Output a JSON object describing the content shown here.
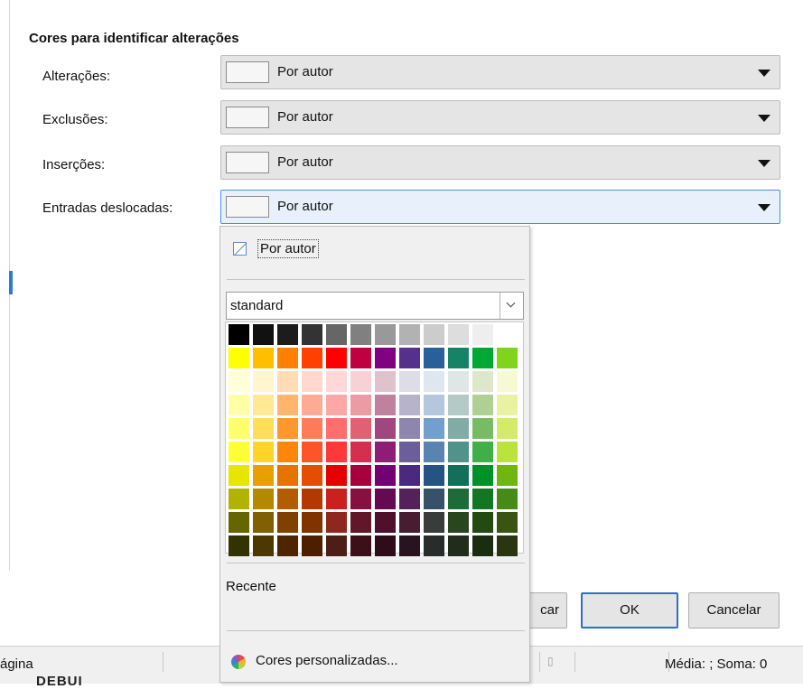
{
  "dialog": {
    "section_title": "Cores para identificar alterações",
    "rows": [
      {
        "label": "Alterações:",
        "value": "Por autor"
      },
      {
        "label": "Exclusões:",
        "value": "Por autor"
      },
      {
        "label": "Inserções:",
        "value": "Por autor"
      },
      {
        "label": "Entradas deslocadas:",
        "value": "Por autor"
      }
    ],
    "buttons": {
      "apply_partial": "car",
      "ok": "OK",
      "cancel": "Cancelar"
    }
  },
  "popup": {
    "auto_label": "Por autor",
    "palette_name": "standard",
    "recent_label": "Recente",
    "custom_colors_label": "Cores personalizadas...",
    "palette_colors": [
      [
        "#000000",
        "#111111",
        "#1c1c1c",
        "#333333",
        "#666666",
        "#808080",
        "#999999",
        "#b2b2b2",
        "#cccccc",
        "#dddddd",
        "#eeeeee",
        "#ffffff"
      ],
      [
        "#ffff00",
        "#ffbf00",
        "#ff8000",
        "#ff4000",
        "#ff0000",
        "#bf0041",
        "#800080",
        "#55308d",
        "#2a6099",
        "#158466",
        "#00a933",
        "#81d41a"
      ],
      [
        "#ffffd7",
        "#fff5ce",
        "#ffdbb6",
        "#ffd8ce",
        "#ffd7d7",
        "#f7d1d5",
        "#e0c2cd",
        "#dedce6",
        "#dee6ef",
        "#dee7e5",
        "#dde8cb",
        "#f6f9d4"
      ],
      [
        "#ffffa6",
        "#ffe994",
        "#ffb66c",
        "#ffaa95",
        "#ffa6a6",
        "#ec9ba4",
        "#bf819e",
        "#b7b3ca",
        "#b4c7dc",
        "#b3cac7",
        "#afd095",
        "#e8f2a1"
      ],
      [
        "#ffff6d",
        "#ffde59",
        "#ff972f",
        "#ff7b59",
        "#ff6d6d",
        "#e16173",
        "#a1467e",
        "#8e86ae",
        "#729fcf",
        "#81aca6",
        "#77bc65",
        "#d4ea6b"
      ],
      [
        "#ffff38",
        "#ffd428",
        "#ff860d",
        "#ff5429",
        "#ff3838",
        "#d62e4e",
        "#8d1d75",
        "#6b5e9b",
        "#5983b0",
        "#50938a",
        "#3faf46",
        "#bbe33d"
      ],
      [
        "#e6e600",
        "#e6a000",
        "#e67300",
        "#e64d00",
        "#e60000",
        "#a8003c",
        "#730073",
        "#4b297f",
        "#255483",
        "#126f59",
        "#009129",
        "#6fb611"
      ],
      [
        "#b2b200",
        "#b28900",
        "#b25e00",
        "#b23a00",
        "#c9211e",
        "#861141",
        "#650953",
        "#55215b",
        "#355269",
        "#1e6a39",
        "#127622",
        "#468a1a"
      ],
      [
        "#666600",
        "#806000",
        "#804000",
        "#803300",
        "#8d281e",
        "#611729",
        "#4e102d",
        "#481d32",
        "#383d3c",
        "#28471f",
        "#224b12",
        "#395511"
      ],
      [
        "#333300",
        "#4d3800",
        "#4d2600",
        "#4d1f00",
        "#4d1e16",
        "#3d1019",
        "#2e0c1a",
        "#2a1320",
        "#282d2c",
        "#1f2d1a",
        "#1a2d10",
        "#2a3610"
      ]
    ]
  },
  "statusbar": {
    "left_text": "ágina",
    "right_text": "Média: ; Soma: 0",
    "bottom_tab_text": "DEBUI"
  }
}
